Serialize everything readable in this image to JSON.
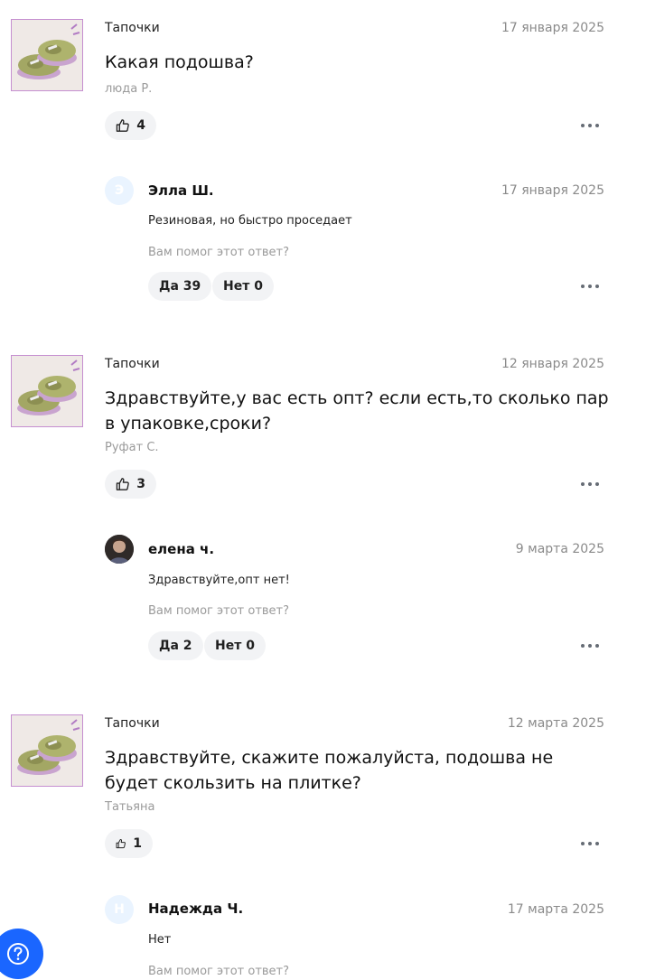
{
  "questions": [
    {
      "product": "Тапочки",
      "date": "17 января 2025",
      "text": "Какая подошва?",
      "author": "люда Р.",
      "likes": "4",
      "answer": {
        "avatar_letter": "Э",
        "name": "Элла Ш.",
        "date": "17 января 2025",
        "text": "Резиновая, но быстро проседает",
        "helpful_prompt": "Вам помог этот ответ?",
        "yes": "Да 39",
        "no": "Нет 0"
      }
    },
    {
      "product": "Тапочки",
      "date": "12 января 2025",
      "text": "Здравствуйте,у вас есть опт? если есть,то сколько пар в упаковке,сроки?",
      "author": "Руфат С.",
      "likes": "3",
      "answer": {
        "avatar_letter": "",
        "name": "елена ч.",
        "date": "9 марта 2025",
        "text": "Здравствуйте,опт нет!",
        "helpful_prompt": "Вам помог этот ответ?",
        "yes": "Да 2",
        "no": "Нет 0"
      }
    },
    {
      "product": "Тапочки",
      "date": "12 марта 2025",
      "text": "Здравствуйте, скажите пожалуйста, подошва не будет скользить на плитке?",
      "author": "Татьяна",
      "likes": "1",
      "answer": {
        "avatar_letter": "Н",
        "name": "Надежда Ч.",
        "date": "17 марта 2025",
        "text": "Нет",
        "helpful_prompt": "Вам помог этот ответ?"
      }
    }
  ],
  "icons": {
    "thumbs_up": "thumbs-up-icon",
    "more": "more-dots-icon",
    "help": "help-question-icon",
    "product_image": "slipper-product-image"
  },
  "colors": {
    "accent": "#1a66ff",
    "chip_bg": "#f2f3f5",
    "muted_text": "#9a9a9a",
    "thumb_border": "#c58fd0"
  }
}
